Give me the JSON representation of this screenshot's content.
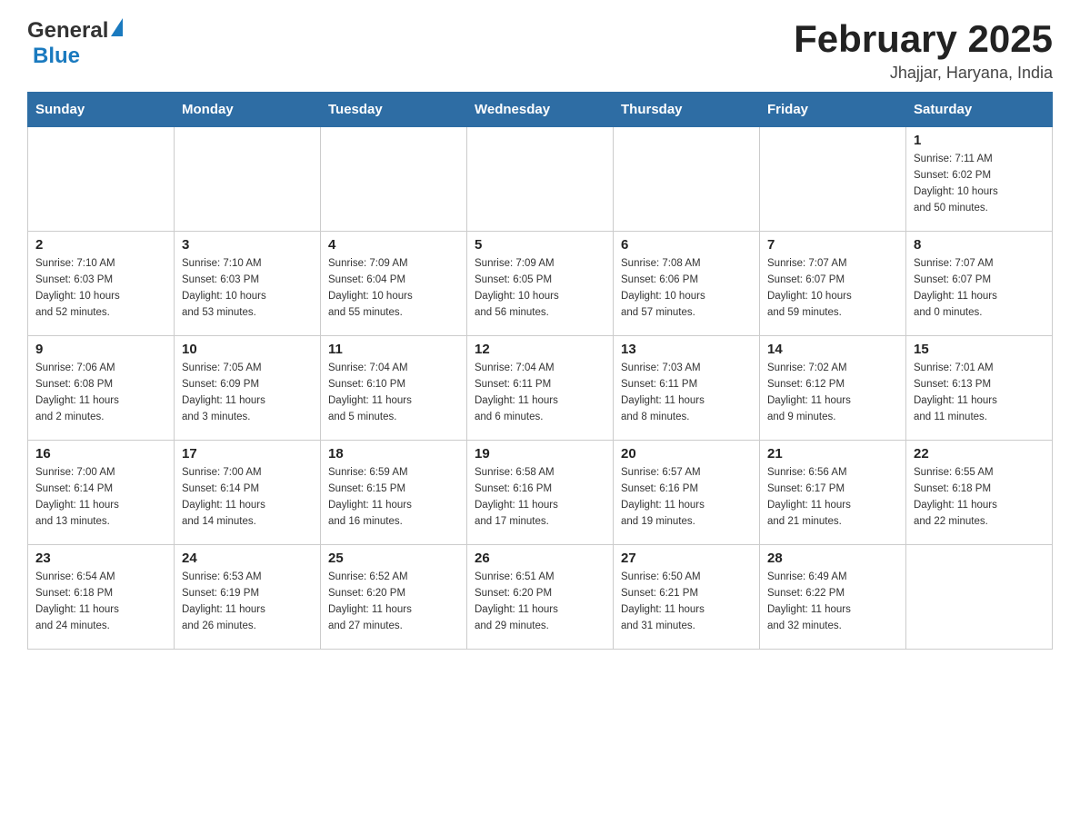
{
  "header": {
    "logo_general": "General",
    "logo_blue": "Blue",
    "title": "February 2025",
    "location": "Jhajjar, Haryana, India"
  },
  "weekdays": [
    "Sunday",
    "Monday",
    "Tuesday",
    "Wednesday",
    "Thursday",
    "Friday",
    "Saturday"
  ],
  "weeks": [
    {
      "days": [
        {
          "number": "",
          "info": ""
        },
        {
          "number": "",
          "info": ""
        },
        {
          "number": "",
          "info": ""
        },
        {
          "number": "",
          "info": ""
        },
        {
          "number": "",
          "info": ""
        },
        {
          "number": "",
          "info": ""
        },
        {
          "number": "1",
          "info": "Sunrise: 7:11 AM\nSunset: 6:02 PM\nDaylight: 10 hours\nand 50 minutes."
        }
      ]
    },
    {
      "days": [
        {
          "number": "2",
          "info": "Sunrise: 7:10 AM\nSunset: 6:03 PM\nDaylight: 10 hours\nand 52 minutes."
        },
        {
          "number": "3",
          "info": "Sunrise: 7:10 AM\nSunset: 6:03 PM\nDaylight: 10 hours\nand 53 minutes."
        },
        {
          "number": "4",
          "info": "Sunrise: 7:09 AM\nSunset: 6:04 PM\nDaylight: 10 hours\nand 55 minutes."
        },
        {
          "number": "5",
          "info": "Sunrise: 7:09 AM\nSunset: 6:05 PM\nDaylight: 10 hours\nand 56 minutes."
        },
        {
          "number": "6",
          "info": "Sunrise: 7:08 AM\nSunset: 6:06 PM\nDaylight: 10 hours\nand 57 minutes."
        },
        {
          "number": "7",
          "info": "Sunrise: 7:07 AM\nSunset: 6:07 PM\nDaylight: 10 hours\nand 59 minutes."
        },
        {
          "number": "8",
          "info": "Sunrise: 7:07 AM\nSunset: 6:07 PM\nDaylight: 11 hours\nand 0 minutes."
        }
      ]
    },
    {
      "days": [
        {
          "number": "9",
          "info": "Sunrise: 7:06 AM\nSunset: 6:08 PM\nDaylight: 11 hours\nand 2 minutes."
        },
        {
          "number": "10",
          "info": "Sunrise: 7:05 AM\nSunset: 6:09 PM\nDaylight: 11 hours\nand 3 minutes."
        },
        {
          "number": "11",
          "info": "Sunrise: 7:04 AM\nSunset: 6:10 PM\nDaylight: 11 hours\nand 5 minutes."
        },
        {
          "number": "12",
          "info": "Sunrise: 7:04 AM\nSunset: 6:11 PM\nDaylight: 11 hours\nand 6 minutes."
        },
        {
          "number": "13",
          "info": "Sunrise: 7:03 AM\nSunset: 6:11 PM\nDaylight: 11 hours\nand 8 minutes."
        },
        {
          "number": "14",
          "info": "Sunrise: 7:02 AM\nSunset: 6:12 PM\nDaylight: 11 hours\nand 9 minutes."
        },
        {
          "number": "15",
          "info": "Sunrise: 7:01 AM\nSunset: 6:13 PM\nDaylight: 11 hours\nand 11 minutes."
        }
      ]
    },
    {
      "days": [
        {
          "number": "16",
          "info": "Sunrise: 7:00 AM\nSunset: 6:14 PM\nDaylight: 11 hours\nand 13 minutes."
        },
        {
          "number": "17",
          "info": "Sunrise: 7:00 AM\nSunset: 6:14 PM\nDaylight: 11 hours\nand 14 minutes."
        },
        {
          "number": "18",
          "info": "Sunrise: 6:59 AM\nSunset: 6:15 PM\nDaylight: 11 hours\nand 16 minutes."
        },
        {
          "number": "19",
          "info": "Sunrise: 6:58 AM\nSunset: 6:16 PM\nDaylight: 11 hours\nand 17 minutes."
        },
        {
          "number": "20",
          "info": "Sunrise: 6:57 AM\nSunset: 6:16 PM\nDaylight: 11 hours\nand 19 minutes."
        },
        {
          "number": "21",
          "info": "Sunrise: 6:56 AM\nSunset: 6:17 PM\nDaylight: 11 hours\nand 21 minutes."
        },
        {
          "number": "22",
          "info": "Sunrise: 6:55 AM\nSunset: 6:18 PM\nDaylight: 11 hours\nand 22 minutes."
        }
      ]
    },
    {
      "days": [
        {
          "number": "23",
          "info": "Sunrise: 6:54 AM\nSunset: 6:18 PM\nDaylight: 11 hours\nand 24 minutes."
        },
        {
          "number": "24",
          "info": "Sunrise: 6:53 AM\nSunset: 6:19 PM\nDaylight: 11 hours\nand 26 minutes."
        },
        {
          "number": "25",
          "info": "Sunrise: 6:52 AM\nSunset: 6:20 PM\nDaylight: 11 hours\nand 27 minutes."
        },
        {
          "number": "26",
          "info": "Sunrise: 6:51 AM\nSunset: 6:20 PM\nDaylight: 11 hours\nand 29 minutes."
        },
        {
          "number": "27",
          "info": "Sunrise: 6:50 AM\nSunset: 6:21 PM\nDaylight: 11 hours\nand 31 minutes."
        },
        {
          "number": "28",
          "info": "Sunrise: 6:49 AM\nSunset: 6:22 PM\nDaylight: 11 hours\nand 32 minutes."
        },
        {
          "number": "",
          "info": ""
        }
      ]
    }
  ]
}
